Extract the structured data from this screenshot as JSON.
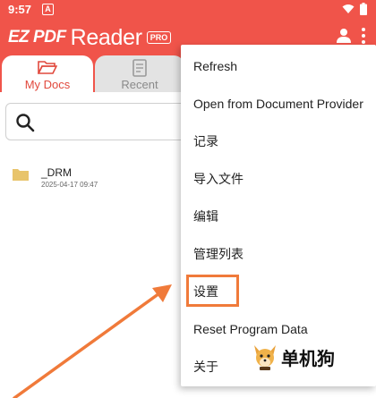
{
  "status_bar": {
    "time": "9:57",
    "notification_glyph": "A",
    "icons": [
      "wifi-icon",
      "battery-icon"
    ]
  },
  "app_bar": {
    "brand_ez": "EZ PDF",
    "brand_reader": "Reader",
    "brand_badge": "PRO",
    "icons": [
      "user-icon",
      "more-vert-icon"
    ]
  },
  "tabs": [
    {
      "label": "My Docs",
      "icon": "folder-open-icon",
      "active": true
    },
    {
      "label": "Recent",
      "icon": "document-icon",
      "active": false
    }
  ],
  "search": {
    "placeholder": "",
    "icon": "search-icon"
  },
  "files": [
    {
      "name": "_DRM",
      "date": "2025-04-17 09:47",
      "icon": "folder-icon"
    }
  ],
  "menu": {
    "items": [
      "Refresh",
      "Open from Document Provider",
      "记录",
      "导入文件",
      "编辑",
      "管理列表",
      "设置",
      "Reset Program Data",
      "关于"
    ],
    "highlighted": "设置"
  },
  "watermark": {
    "text": "单机狗"
  },
  "colors": {
    "header": "#f0544a",
    "accent": "#e1493d",
    "annotation": "#f07a3a"
  }
}
